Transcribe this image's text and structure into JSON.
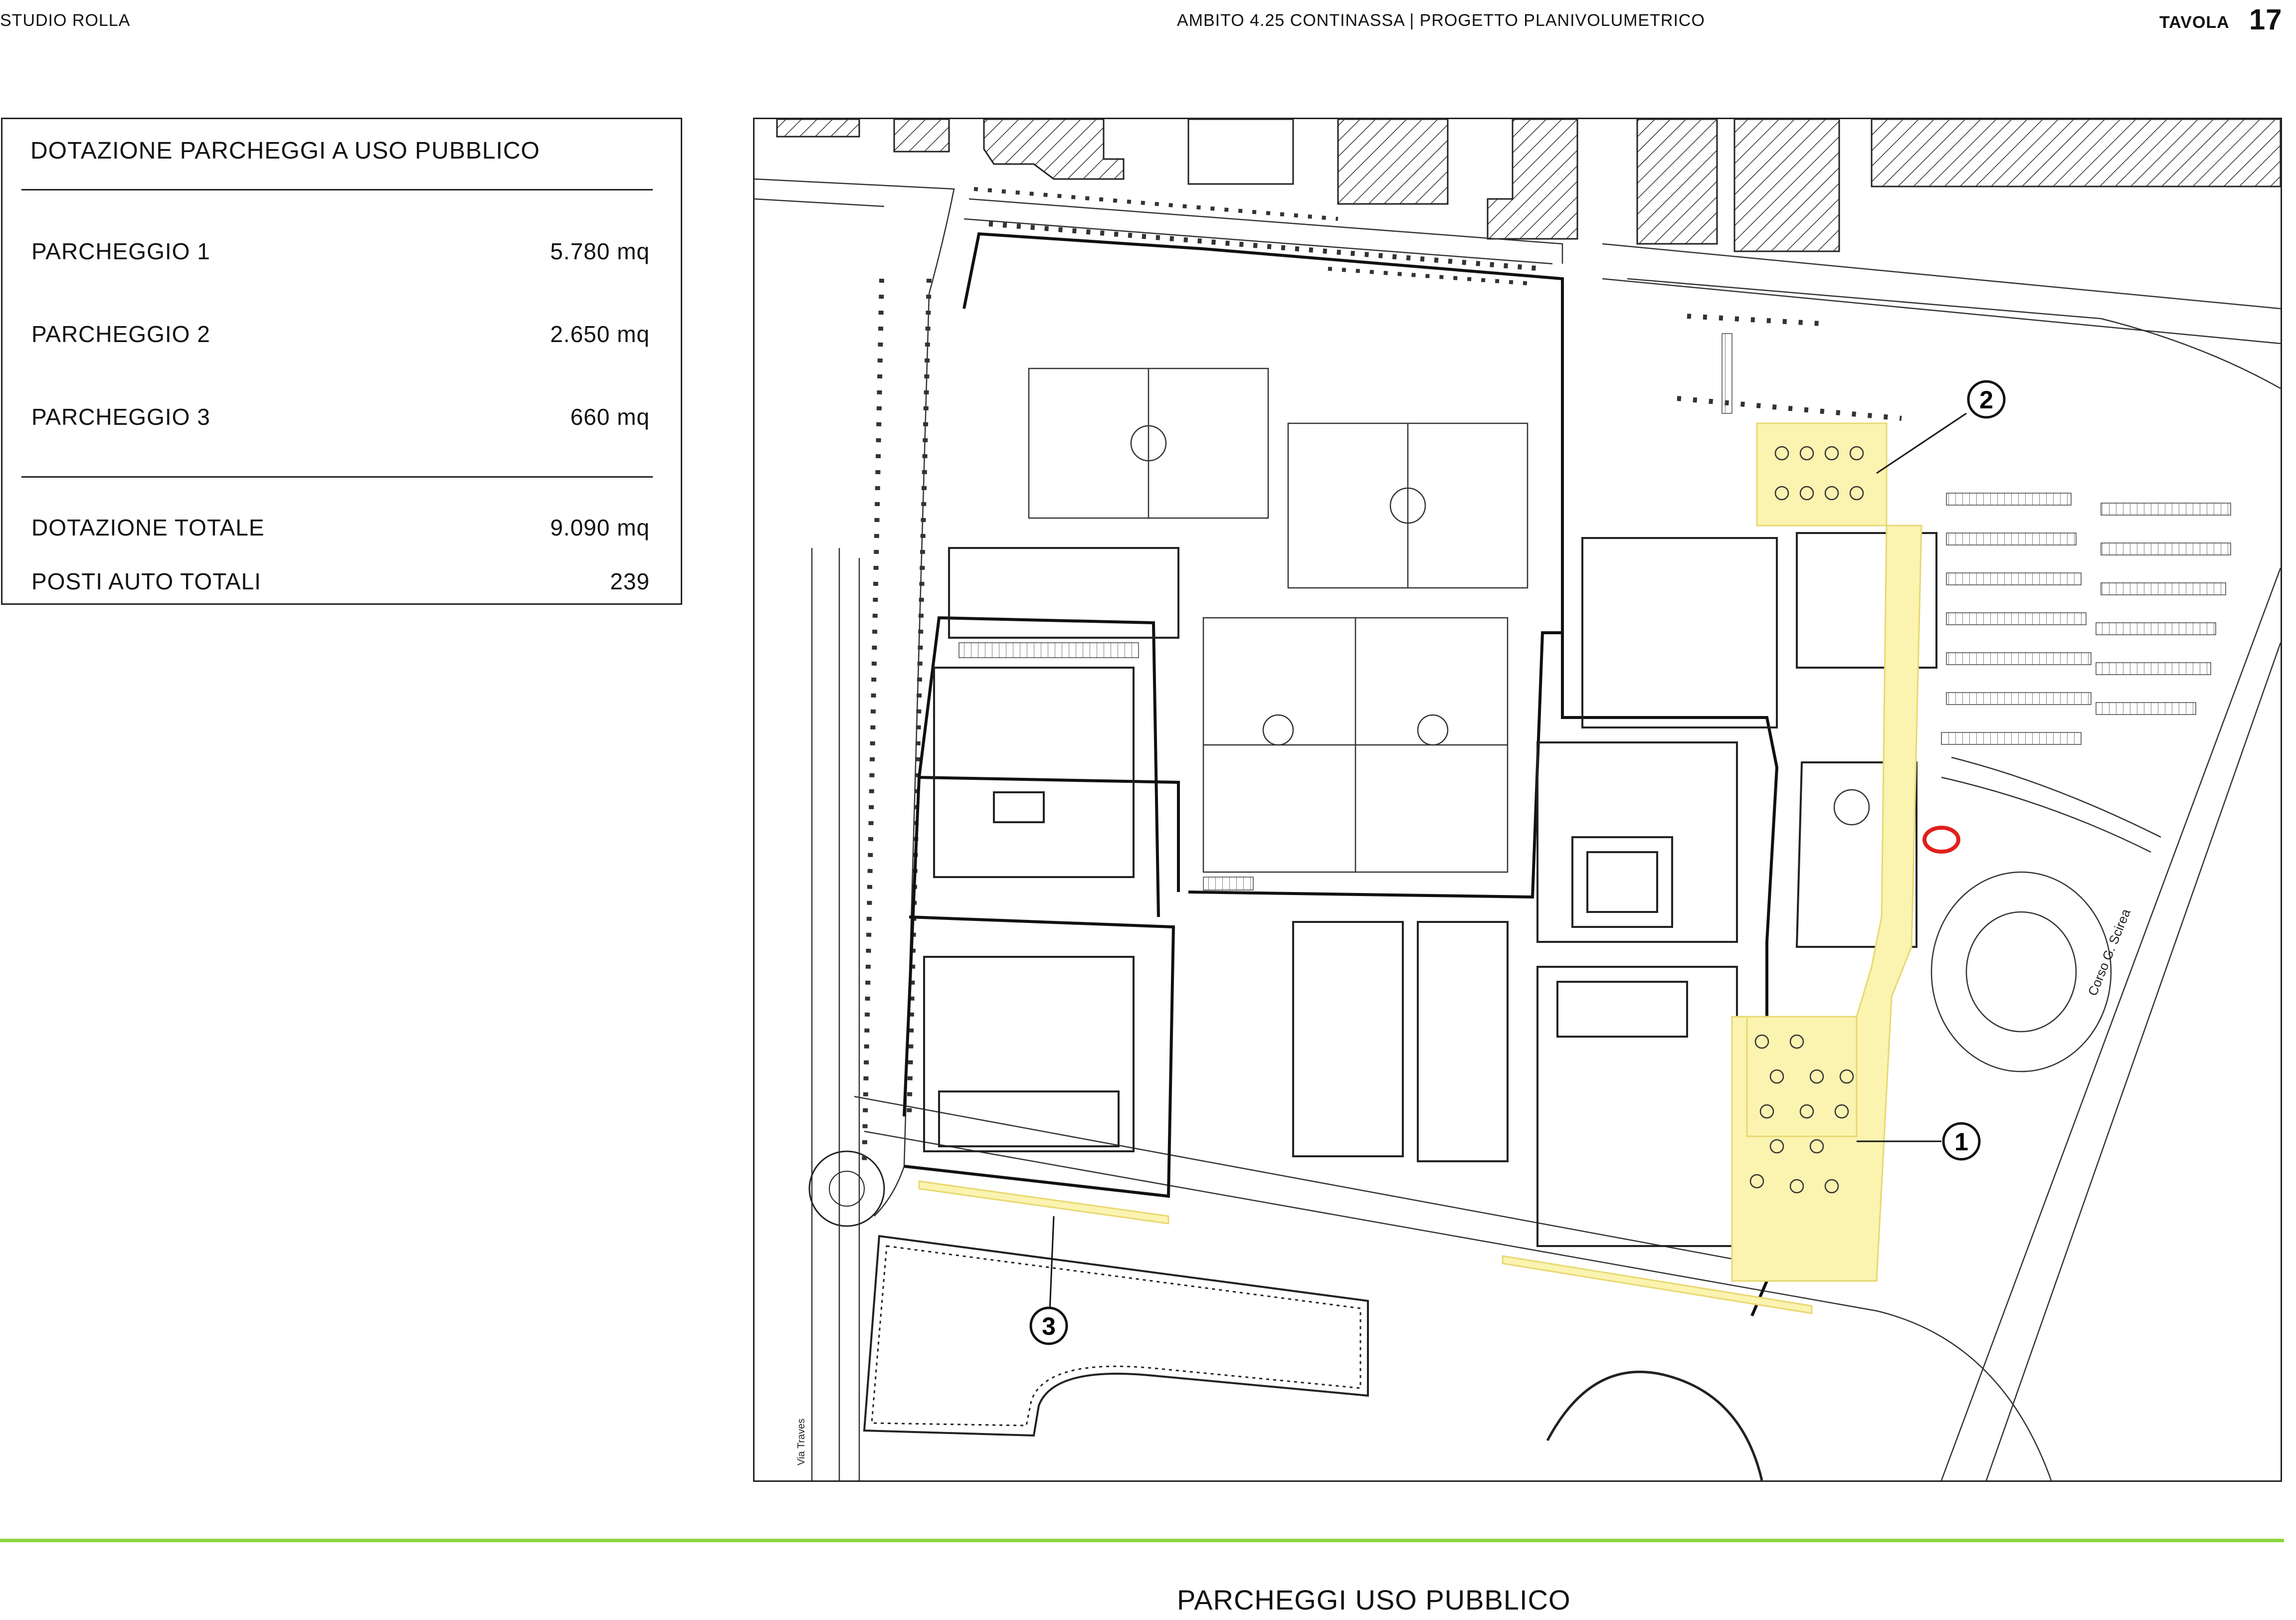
{
  "header": {
    "studio": "STUDIO ROLLA",
    "project": "AMBITO 4.25 CONTINASSA | PROGETTO PLANIVOLUMETRICO",
    "tavola_label": "TAVOLA",
    "tavola_number": "17"
  },
  "legend": {
    "title": "DOTAZIONE PARCHEGGI A USO PUBBLICO",
    "rows": [
      {
        "label": "PARCHEGGIO 1",
        "value": "5.780 mq"
      },
      {
        "label": "PARCHEGGIO 2",
        "value": "2.650 mq"
      },
      {
        "label": "PARCHEGGIO 3",
        "value": "660 mq"
      }
    ],
    "totals": [
      {
        "label": "DOTAZIONE TOTALE",
        "value": "9.090 mq"
      },
      {
        "label": "POSTI AUTO TOTALI",
        "value": "239"
      }
    ]
  },
  "map": {
    "markers": [
      "1",
      "2",
      "3"
    ],
    "street_labels": [
      "Corso G. Scirea",
      "Via Traves"
    ],
    "colors": {
      "parking_highlight": "#fbf3b0",
      "parking_outline": "#e8d870",
      "ink": "#1a1a1a",
      "hatch": "#333333",
      "red_mark": "#e0201c"
    }
  },
  "footer": {
    "title": "PARCHEGGI USO PUBBLICO",
    "rule_color": "#8cd640"
  }
}
